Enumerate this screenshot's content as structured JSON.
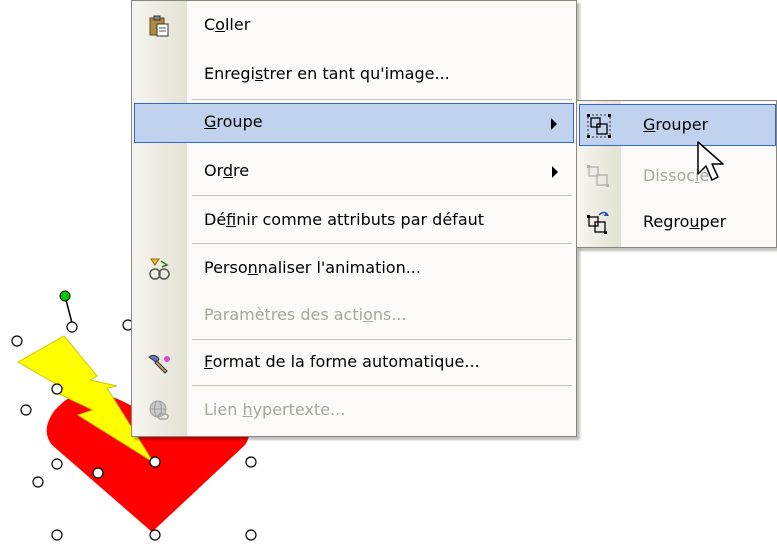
{
  "context_menu": {
    "items": [
      {
        "label_pre": "C",
        "label_ul": "o",
        "label_post": "ller",
        "icon": "paste-icon",
        "disabled": false
      },
      {
        "label_pre": "Enregi",
        "label_ul": "s",
        "label_post": "trer en tant qu'image...",
        "icon": "",
        "disabled": false
      },
      {
        "label_pre": "",
        "label_ul": "G",
        "label_post": "roupe",
        "icon": "",
        "disabled": false,
        "submenu": true,
        "highlighted": true
      },
      {
        "label_pre": "Or",
        "label_ul": "d",
        "label_post": "re",
        "icon": "",
        "disabled": false,
        "submenu": true
      },
      {
        "label_pre": "Dé",
        "label_ul": "f",
        "label_post": "inir comme attributs par défaut",
        "icon": "",
        "disabled": false
      },
      {
        "label_pre": "Perso",
        "label_ul": "n",
        "label_post": "naliser l'animation...",
        "icon": "custom-animation-icon",
        "disabled": false
      },
      {
        "label_pre": "Paramètres des acti",
        "label_ul": "o",
        "label_post": "ns...",
        "icon": "",
        "disabled": true
      },
      {
        "label_pre": "",
        "label_ul": "F",
        "label_post": "ormat de la forme automatique...",
        "icon": "format-shape-icon",
        "disabled": false
      },
      {
        "label_pre": "Lien ",
        "label_ul": "h",
        "label_post": "ypertexte...",
        "icon": "hyperlink-icon",
        "disabled": true
      }
    ]
  },
  "group_submenu": {
    "items": [
      {
        "label_pre": "",
        "label_ul": "G",
        "label_post": "rouper",
        "icon": "group-icon",
        "disabled": false,
        "highlighted": true
      },
      {
        "label_pre": "Dissoc",
        "label_ul": "i",
        "label_post": "er",
        "icon": "ungroup-icon",
        "disabled": true
      },
      {
        "label_pre": "Regro",
        "label_ul": "u",
        "label_post": "per",
        "icon": "regroup-icon",
        "disabled": false
      }
    ]
  },
  "colors": {
    "highlight_fill": "#c1d2ee",
    "highlight_border": "#316ac5",
    "heart": "#ff0000",
    "lightning": "#ffff00",
    "rotation_handle": "#00cc00"
  }
}
